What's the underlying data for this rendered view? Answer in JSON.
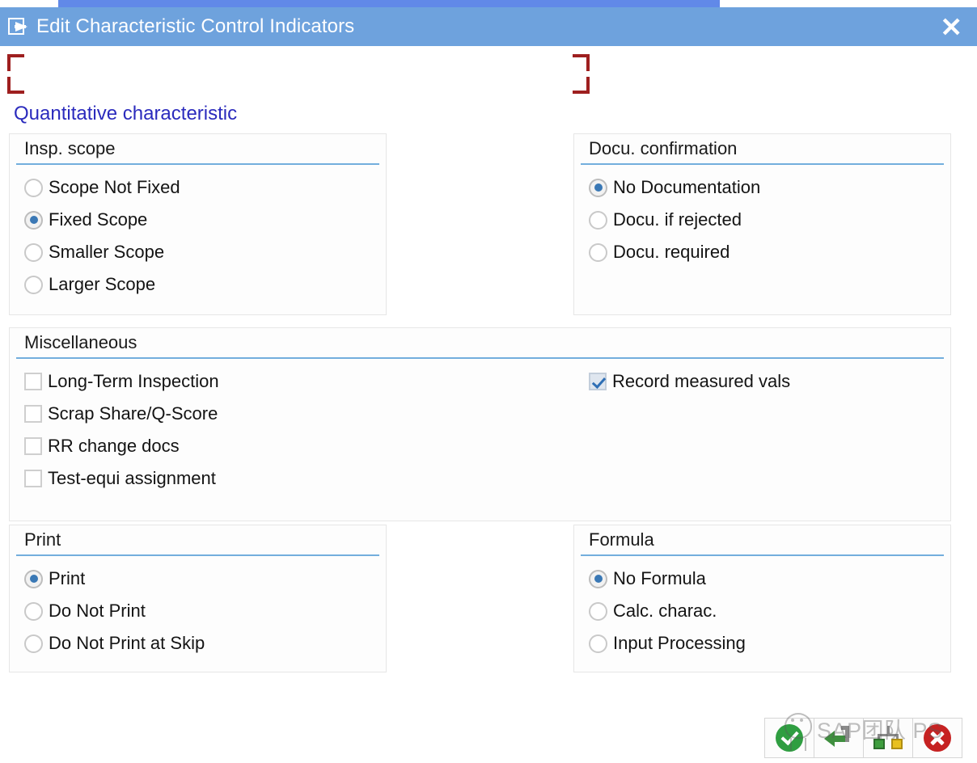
{
  "window": {
    "title": "Edit Characteristic Control Indicators",
    "icon": "edit-document-icon",
    "close_label": "✕",
    "accent_color": "#6ea2dd",
    "rule_color": "#73aedd"
  },
  "headline": {
    "text": "Quantitative characteristic",
    "color": "#2b2bbd"
  },
  "groups": {
    "insp_scope": {
      "title": "Insp. scope",
      "options": [
        {
          "label": "Scope Not Fixed",
          "selected": false
        },
        {
          "label": "Fixed Scope",
          "selected": true
        },
        {
          "label": "Smaller Scope",
          "selected": false
        },
        {
          "label": "Larger Scope",
          "selected": false
        }
      ]
    },
    "docu_confirmation": {
      "title": "Docu. confirmation",
      "options": [
        {
          "label": "No Documentation",
          "selected": true
        },
        {
          "label": "Docu. if rejected",
          "selected": false
        },
        {
          "label": "Docu. required",
          "selected": false
        }
      ]
    },
    "miscellaneous": {
      "title": "Miscellaneous",
      "left_checkboxes": [
        {
          "label": "Long-Term Inspection",
          "checked": false
        },
        {
          "label": "Scrap Share/Q-Score",
          "checked": false
        },
        {
          "label": "RR change docs",
          "checked": false
        },
        {
          "label": "Test-equi assignment",
          "checked": false
        }
      ],
      "right_checkboxes": [
        {
          "label": "Record measured vals",
          "checked": true
        }
      ]
    },
    "print": {
      "title": "Print",
      "options": [
        {
          "label": "Print",
          "selected": true
        },
        {
          "label": "Do Not Print",
          "selected": false
        },
        {
          "label": "Do Not Print at Skip",
          "selected": false
        }
      ]
    },
    "formula": {
      "title": "Formula",
      "options": [
        {
          "label": "No Formula",
          "selected": true
        },
        {
          "label": "Calc. charac.",
          "selected": false
        },
        {
          "label": "Input Processing",
          "selected": false
        }
      ]
    }
  },
  "toolbar": {
    "buttons": [
      {
        "name": "continue-button",
        "icon": "green-check-icon"
      },
      {
        "name": "back-button",
        "icon": "green-back-arrow-icon"
      },
      {
        "name": "detail-button",
        "icon": "green-yellow-nodes-icon"
      },
      {
        "name": "cancel-button",
        "icon": "red-x-icon"
      }
    ]
  },
  "watermark": {
    "text": "SAP团队 PS"
  }
}
